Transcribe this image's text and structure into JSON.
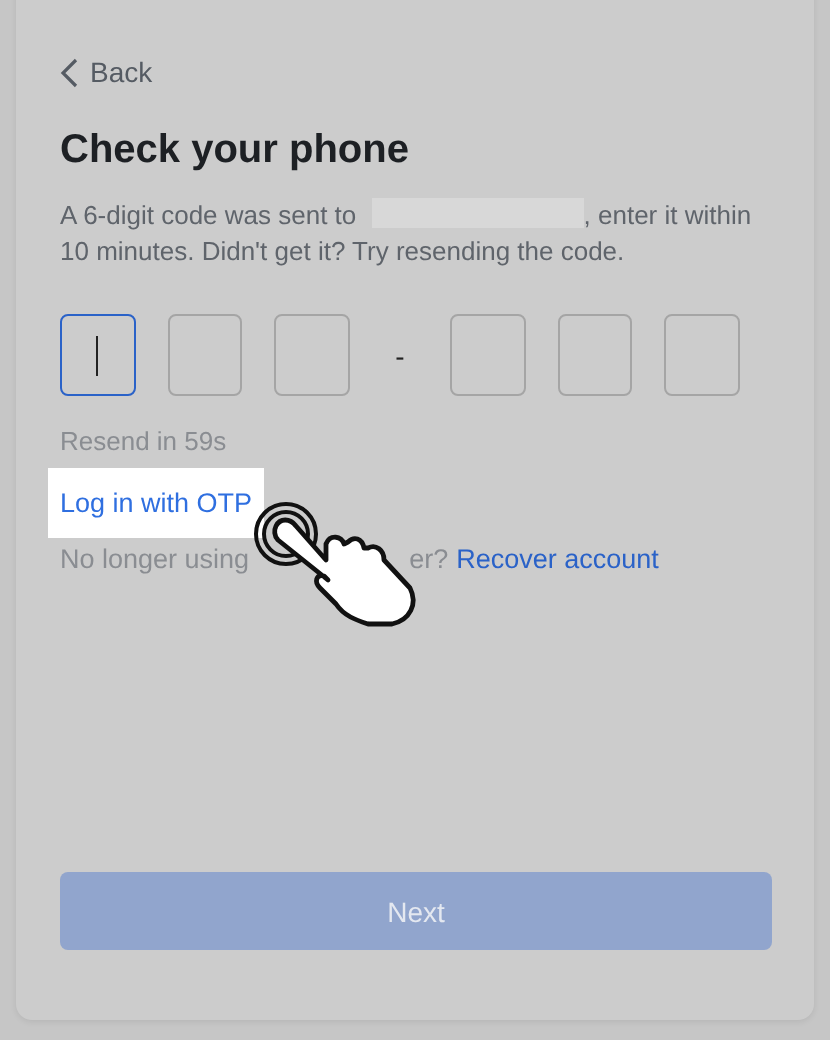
{
  "back": {
    "label": "Back"
  },
  "title": "Check your phone",
  "message": {
    "before": "A 6-digit code was sent to",
    "after": ", enter it within 10 minutes. Didn't get it? Try resending the code."
  },
  "code_digits": [
    {
      "focused": true
    },
    {
      "focused": false
    },
    {
      "focused": false
    },
    {
      "focused": false
    },
    {
      "focused": false
    },
    {
      "focused": false
    }
  ],
  "separator": "-",
  "resend": "Resend in 59s",
  "otp_link": {
    "label": "Log in with OTP",
    "highlighted": true
  },
  "recover": {
    "text_before": "No longer using",
    "text_after": "er?",
    "link": "Recover account"
  },
  "next_button": {
    "label": "Next",
    "disabled": true
  }
}
